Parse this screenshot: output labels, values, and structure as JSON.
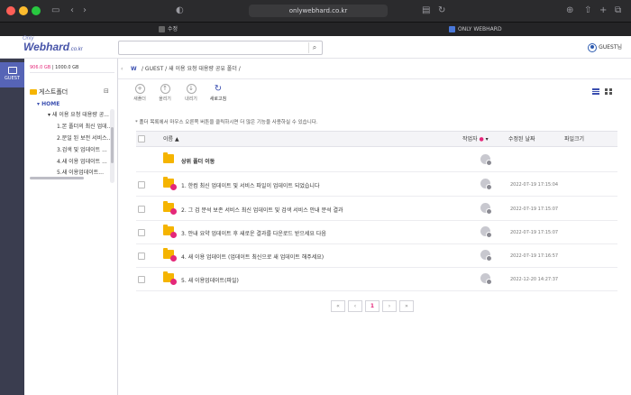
{
  "browser": {
    "url": "onlywebhard.co.kr",
    "tabs": [
      {
        "label": "수정"
      },
      {
        "label": "ONLY WEBHARD"
      }
    ]
  },
  "header": {
    "logo_top": "Only",
    "logo_main": "Webhard",
    "logo_suffix": ".co.kr",
    "search_placeholder": "",
    "user_label": "GUEST님"
  },
  "rail": {
    "guest_label": "GUEST"
  },
  "sidebar": {
    "quota_used": "906.0 GB",
    "quota_total": "1000.0 GB",
    "folder_header": "게스트폴더",
    "tree": [
      {
        "label": "HOME"
      },
      {
        "label": "새 이용 요청 대용량 공..."
      },
      {
        "label": "1.본 폴더의 최신 업데..."
      },
      {
        "label": "2.문일 된 보전 서비스..."
      },
      {
        "label": "3.검색 및 업데이트 ..."
      },
      {
        "label": "4.새 이용 업데이트 ..."
      },
      {
        "label": "5.새 이용업데이트..."
      }
    ]
  },
  "content": {
    "breadcrumb": "/ GUEST / 새 이용 요청 대용량 공유 폴더 /",
    "actions": [
      {
        "label": "새폴더",
        "icon": "+"
      },
      {
        "label": "올리기",
        "icon": "↑"
      },
      {
        "label": "내리기",
        "icon": "↓"
      },
      {
        "label": "새로고침",
        "icon": "↻"
      }
    ],
    "notice": "* 폴더 목록에서 마우스 오른쪽 버튼을 클릭하시면 더 많은 기능을 사용하실 수 있습니다.",
    "columns": {
      "name": "이름 ▲",
      "owner": "작업자",
      "date": "수정된 날짜",
      "size": "파일크기"
    },
    "rows": [
      {
        "name": "상위 폴더 이동",
        "date": "",
        "parent": true
      },
      {
        "name": "1. 한컴 최신 업데이트 및 서비스 파일이 업데이트 되었습니다",
        "date": "2022-07-19 17:15:04"
      },
      {
        "name": "2. 그 검 분석 보존 서비스 최신 업데이트 및 검색 서비스 안내 분석 결과",
        "date": "2022-07-19 17:15:07"
      },
      {
        "name": "3. 안내 요약 업데이트 후 새로운 결과를 다운로드 받으세요 다음",
        "date": "2022-07-19 17:15:07"
      },
      {
        "name": "4. 새 이용 업데이트 (업데이트 최신으로 새 업데이트 해주세요)",
        "date": "2022-07-19 17:16:57"
      },
      {
        "name": "5. 새 이용업데이트(파일)",
        "date": "2022-12-20 14:27:37"
      }
    ],
    "pager": {
      "first": "«",
      "prev": "‹",
      "current": "1",
      "next": "›",
      "last": "»"
    }
  },
  "colors": {
    "accent": "#3b4fb0",
    "pink": "#e4287a",
    "folder": "#f5b400",
    "rail": "#3a3d4f"
  }
}
